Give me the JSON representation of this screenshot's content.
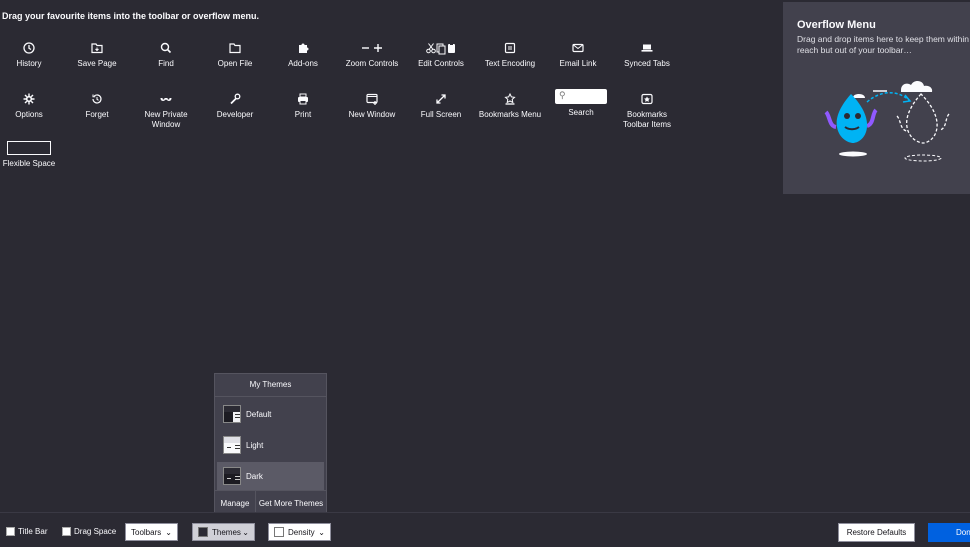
{
  "instructions": "Drag your favourite items into the toolbar or overflow menu.",
  "palette": {
    "row1": [
      {
        "label": "History",
        "icon": "clock-icon"
      },
      {
        "label": "Save Page",
        "icon": "folder-save-icon"
      },
      {
        "label": "Find",
        "icon": "search-icon"
      },
      {
        "label": "Open File",
        "icon": "folder-icon"
      },
      {
        "label": "Add-ons",
        "icon": "puzzle-icon"
      },
      {
        "label": "Zoom Controls",
        "icon": "zoom-icon"
      },
      {
        "label": "Edit Controls",
        "icon": "edit-icon"
      },
      {
        "label": "Text Encoding",
        "icon": "text-encoding-icon"
      },
      {
        "label": "Email Link",
        "icon": "mail-icon"
      },
      {
        "label": "Synced Tabs",
        "icon": "synced-tabs-icon"
      }
    ],
    "row2": [
      {
        "label": "Options",
        "icon": "gear-icon"
      },
      {
        "label": "Forget",
        "icon": "forget-icon"
      },
      {
        "label": "New Private Window",
        "icon": "mask-icon"
      },
      {
        "label": "Developer",
        "icon": "wrench-icon"
      },
      {
        "label": "Print",
        "icon": "printer-icon"
      },
      {
        "label": "New Window",
        "icon": "new-window-icon"
      },
      {
        "label": "Full Screen",
        "icon": "fullscreen-icon"
      },
      {
        "label": "Bookmarks Menu",
        "icon": "bookmarks-menu-icon"
      },
      {
        "label": "Search",
        "icon": "search-field-icon"
      },
      {
        "label": "Bookmarks Toolbar Items",
        "icon": "bookmarks-toolbar-icon"
      }
    ],
    "flexible_space": "Flexible Space"
  },
  "overflow": {
    "title": "Overflow Menu",
    "description": "Drag and drop items here to keep them within reach but out of your toolbar…"
  },
  "themes_popup": {
    "title": "My Themes",
    "items": [
      {
        "label": "Default",
        "selected": false
      },
      {
        "label": "Light",
        "selected": false
      },
      {
        "label": "Dark",
        "selected": true
      }
    ],
    "manage": "Manage",
    "get_more": "Get More Themes"
  },
  "bottom": {
    "title_bar": "Title Bar",
    "drag_space": "Drag Space",
    "toolbars": "Toolbars",
    "themes": "Themes",
    "density": "Density",
    "restore": "Restore Defaults",
    "done": "Done"
  },
  "colors": {
    "background": "#2b2a33",
    "panel": "#42414d",
    "accent": "#0061e0"
  }
}
